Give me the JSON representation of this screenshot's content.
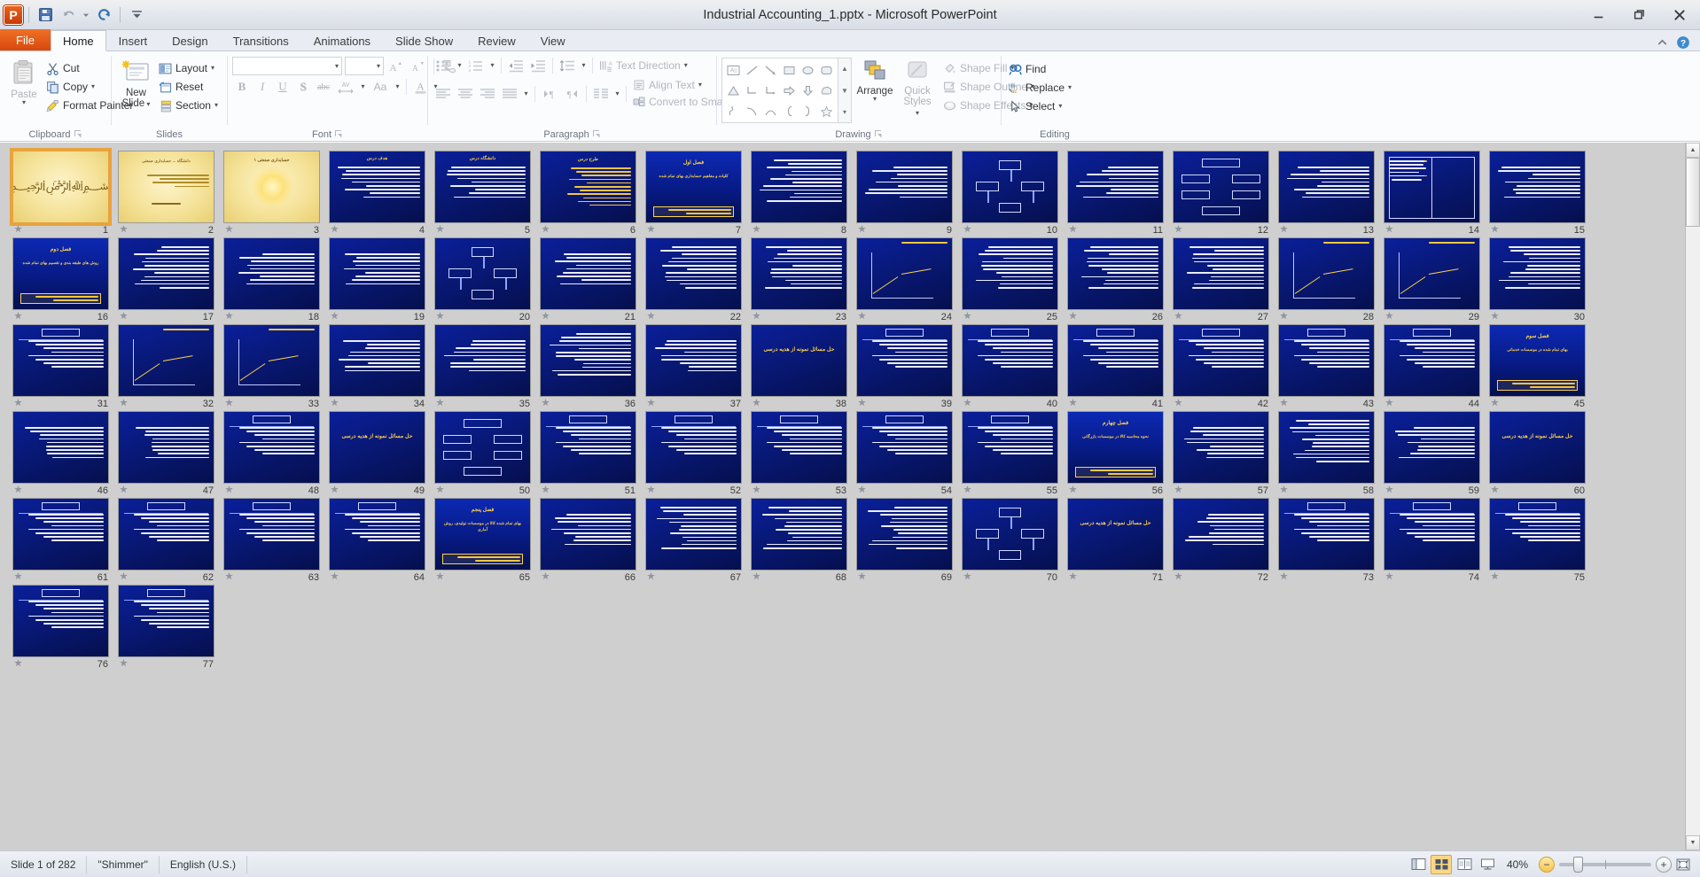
{
  "window": {
    "title": "Industrial Accounting_1.pptx  -  Microsoft PowerPoint",
    "minimize_label": "Minimize",
    "restore_label": "Restore Down",
    "close_label": "Close"
  },
  "quick_access": {
    "app_letter": "P",
    "items": [
      {
        "name": "save-icon",
        "label": "Save"
      },
      {
        "name": "undo-icon",
        "label": "Undo"
      },
      {
        "name": "redo-icon",
        "label": "Redo"
      },
      {
        "name": "customize-icon",
        "label": "Customize Quick Access Toolbar"
      }
    ]
  },
  "tabs": {
    "file": "File",
    "items": [
      {
        "label": "Home",
        "active": true
      },
      {
        "label": "Insert",
        "active": false
      },
      {
        "label": "Design",
        "active": false
      },
      {
        "label": "Transitions",
        "active": false
      },
      {
        "label": "Animations",
        "active": false
      },
      {
        "label": "Slide Show",
        "active": false
      },
      {
        "label": "Review",
        "active": false
      },
      {
        "label": "View",
        "active": false
      }
    ],
    "minimize_ribbon": "Minimize the Ribbon",
    "help": "Microsoft PowerPoint Help"
  },
  "ribbon": {
    "groups": {
      "clipboard": {
        "label": "Clipboard",
        "paste": "Paste",
        "cut": "Cut",
        "copy": "Copy",
        "format_painter": "Format Painter"
      },
      "slides": {
        "label": "Slides",
        "new_slide": "New\nSlide",
        "new_slide_line1": "New",
        "new_slide_line2": "Slide",
        "layout": "Layout",
        "reset": "Reset",
        "section": "Section"
      },
      "font": {
        "label": "Font",
        "font_name_value": "",
        "font_size_value": "",
        "grow_font": "Increase Font Size",
        "shrink_font": "Decrease Font Size",
        "clear_formatting": "Clear All Formatting",
        "bold": "B",
        "italic": "I",
        "underline": "U",
        "shadow": "S",
        "strikethrough": "abc",
        "character_spacing": "AV",
        "change_case": "Aa",
        "font_color": "A"
      },
      "paragraph": {
        "label": "Paragraph",
        "bullets": "Bullets",
        "numbering": "Numbering",
        "decrease_indent": "Decrease List Level",
        "increase_indent": "Increase List Level",
        "line_spacing": "Line Spacing",
        "align_left": "Align Text Left",
        "center": "Center",
        "align_right": "Align Text Right",
        "justify": "Justify",
        "ltr": "Left-to-Right",
        "rtl": "Right-to-Left",
        "columns": "Columns",
        "text_direction": "Text Direction",
        "align_text": "Align Text",
        "convert_to_smartart": "Convert to SmartArt"
      },
      "drawing": {
        "label": "Drawing",
        "arrange": "Arrange",
        "quick_styles_line1": "Quick",
        "quick_styles_line2": "Styles",
        "shape_fill": "Shape Fill",
        "shape_outline": "Shape Outline",
        "shape_effects": "Shape Effects",
        "shapes": [
          "text-box-shape",
          "line-shape",
          "arrow-shape",
          "rectangle-shape",
          "oval-shape",
          "rounded-rectangle-shape",
          "triangle-shape",
          "elbow-connector-shape",
          "elbow-arrow-connector-shape",
          "right-arrow-shape",
          "down-arrow-shape",
          "cloud-shape",
          "scribble-shape",
          "curve-shape",
          "arc-shape",
          "left-brace-shape",
          "right-brace-shape",
          "star-shape"
        ]
      },
      "editing": {
        "label": "Editing",
        "find": "Find",
        "replace": "Replace",
        "select": "Select"
      }
    }
  },
  "status_bar": {
    "slide_indicator": "Slide 1 of 282",
    "theme": "\"Shimmer\"",
    "language": "English (U.S.)",
    "zoom_level": "40%",
    "views": [
      {
        "name": "normal-view-button",
        "label": "Normal",
        "active": false
      },
      {
        "name": "slide-sorter-view-button",
        "label": "Slide Sorter",
        "active": true
      },
      {
        "name": "reading-view-button",
        "label": "Reading View",
        "active": false
      },
      {
        "name": "slide-show-view-button",
        "label": "Slide Show",
        "active": false
      }
    ],
    "zoom_out_label": "Zoom Out",
    "zoom_in_label": "Zoom In",
    "fit_to_window_label": "Fit slide to current window"
  },
  "sorter": {
    "selected_slide": 1,
    "total_slides": 282,
    "slides": [
      {
        "n": 1,
        "kind": "gold-calligraphy",
        "anim": true
      },
      {
        "n": 2,
        "kind": "gold-text",
        "anim": true,
        "title": "دانشگاه ... حسابداری صنعتی"
      },
      {
        "n": 3,
        "kind": "gold-sun",
        "anim": true,
        "title": "حسابداری صنعتی ۱"
      },
      {
        "n": 4,
        "kind": "title-body",
        "anim": true,
        "title": "هدف درس"
      },
      {
        "n": 5,
        "kind": "title-body",
        "anim": true,
        "title": "دانشگاه درس"
      },
      {
        "n": 6,
        "kind": "title-list",
        "anim": true,
        "title": "طرح درس"
      },
      {
        "n": 7,
        "kind": "section",
        "anim": true,
        "title": "فصل اول",
        "subtitle": "کلیات و مفاهیم حسابداری بهای تمام شده"
      },
      {
        "n": 8,
        "kind": "body",
        "anim": true
      },
      {
        "n": 9,
        "kind": "title-body",
        "anim": true
      },
      {
        "n": 10,
        "kind": "diagram",
        "anim": true
      },
      {
        "n": 11,
        "kind": "title-body",
        "anim": true
      },
      {
        "n": 12,
        "kind": "diagram2",
        "anim": true
      },
      {
        "n": 13,
        "kind": "title-body",
        "anim": true
      },
      {
        "n": 14,
        "kind": "two-col",
        "anim": true
      },
      {
        "n": 15,
        "kind": "title-body",
        "anim": true
      },
      {
        "n": 16,
        "kind": "section",
        "anim": true,
        "title": "فصل دوم",
        "subtitle": "روش های طبقه بندی و تقسیم بهای تمام شده"
      },
      {
        "n": 17,
        "kind": "body",
        "anim": true
      },
      {
        "n": 18,
        "kind": "title-body",
        "anim": true
      },
      {
        "n": 19,
        "kind": "title-body",
        "anim": true
      },
      {
        "n": 20,
        "kind": "diagram",
        "anim": true
      },
      {
        "n": 21,
        "kind": "title-body",
        "anim": true
      },
      {
        "n": 22,
        "kind": "body",
        "anim": true
      },
      {
        "n": 23,
        "kind": "body",
        "anim": true
      },
      {
        "n": 24,
        "kind": "chart",
        "anim": true
      },
      {
        "n": 25,
        "kind": "body",
        "anim": true
      },
      {
        "n": 26,
        "kind": "body",
        "anim": true
      },
      {
        "n": 27,
        "kind": "body",
        "anim": true
      },
      {
        "n": 28,
        "kind": "chart",
        "anim": true
      },
      {
        "n": 29,
        "kind": "chart",
        "anim": true
      },
      {
        "n": 30,
        "kind": "body",
        "anim": true
      },
      {
        "n": 31,
        "kind": "table",
        "anim": true
      },
      {
        "n": 32,
        "kind": "chart",
        "anim": true
      },
      {
        "n": 33,
        "kind": "chart",
        "anim": true
      },
      {
        "n": 34,
        "kind": "title-body",
        "anim": true
      },
      {
        "n": 35,
        "kind": "title-body",
        "anim": true
      },
      {
        "n": 36,
        "kind": "body",
        "anim": true
      },
      {
        "n": 37,
        "kind": "title-body",
        "anim": true
      },
      {
        "n": 38,
        "kind": "exercise",
        "anim": true,
        "title": "حل مسائل نمونه از هدیه درسی"
      },
      {
        "n": 39,
        "kind": "table",
        "anim": true
      },
      {
        "n": 40,
        "kind": "table",
        "anim": true
      },
      {
        "n": 41,
        "kind": "table",
        "anim": true
      },
      {
        "n": 42,
        "kind": "table",
        "anim": true
      },
      {
        "n": 43,
        "kind": "table",
        "anim": true
      },
      {
        "n": 44,
        "kind": "table",
        "anim": true
      },
      {
        "n": 45,
        "kind": "section",
        "anim": true,
        "title": "فصل سوم",
        "subtitle": "بهای تمام شده در موسسات خدماتی"
      },
      {
        "n": 46,
        "kind": "title-body",
        "anim": true
      },
      {
        "n": 47,
        "kind": "title-body",
        "anim": true
      },
      {
        "n": 48,
        "kind": "table",
        "anim": true
      },
      {
        "n": 49,
        "kind": "exercise",
        "anim": true,
        "title": "حل مسائل نمونه از هدیه درسی"
      },
      {
        "n": 50,
        "kind": "diagram2",
        "anim": true
      },
      {
        "n": 51,
        "kind": "table",
        "anim": true
      },
      {
        "n": 52,
        "kind": "table",
        "anim": true
      },
      {
        "n": 53,
        "kind": "table",
        "anim": true
      },
      {
        "n": 54,
        "kind": "table",
        "anim": true
      },
      {
        "n": 55,
        "kind": "table",
        "anim": true
      },
      {
        "n": 56,
        "kind": "section",
        "anim": true,
        "title": "فصل چهارم",
        "subtitle": "نحوه محاسبه کالا در موسسات بازرگانی"
      },
      {
        "n": 57,
        "kind": "title-body",
        "anim": true
      },
      {
        "n": 58,
        "kind": "body",
        "anim": true
      },
      {
        "n": 59,
        "kind": "title-body",
        "anim": true
      },
      {
        "n": 60,
        "kind": "exercise",
        "anim": true,
        "title": "حل مسائل نمونه از هدیه درسی"
      },
      {
        "n": 61,
        "kind": "table",
        "anim": true
      },
      {
        "n": 62,
        "kind": "table",
        "anim": true
      },
      {
        "n": 63,
        "kind": "table",
        "anim": true
      },
      {
        "n": 64,
        "kind": "table",
        "anim": true
      },
      {
        "n": 65,
        "kind": "section",
        "anim": true,
        "title": "فصل پنجم",
        "subtitle": "بهای تمام شده کالا در موسسات تولیدی، روش آماری"
      },
      {
        "n": 66,
        "kind": "title-body",
        "anim": true
      },
      {
        "n": 67,
        "kind": "body",
        "anim": true
      },
      {
        "n": 68,
        "kind": "body",
        "anim": true
      },
      {
        "n": 69,
        "kind": "body",
        "anim": true
      },
      {
        "n": 70,
        "kind": "diagram",
        "anim": true
      },
      {
        "n": 71,
        "kind": "exercise",
        "anim": true,
        "title": "حل مسائل نمونه از هدیه درسی"
      },
      {
        "n": 72,
        "kind": "title-body",
        "anim": true
      },
      {
        "n": 73,
        "kind": "table",
        "anim": true
      },
      {
        "n": 74,
        "kind": "table",
        "anim": true
      },
      {
        "n": 75,
        "kind": "table",
        "anim": true
      },
      {
        "n": 76,
        "kind": "table",
        "anim": true
      },
      {
        "n": 77,
        "kind": "table",
        "anim": true
      }
    ]
  }
}
